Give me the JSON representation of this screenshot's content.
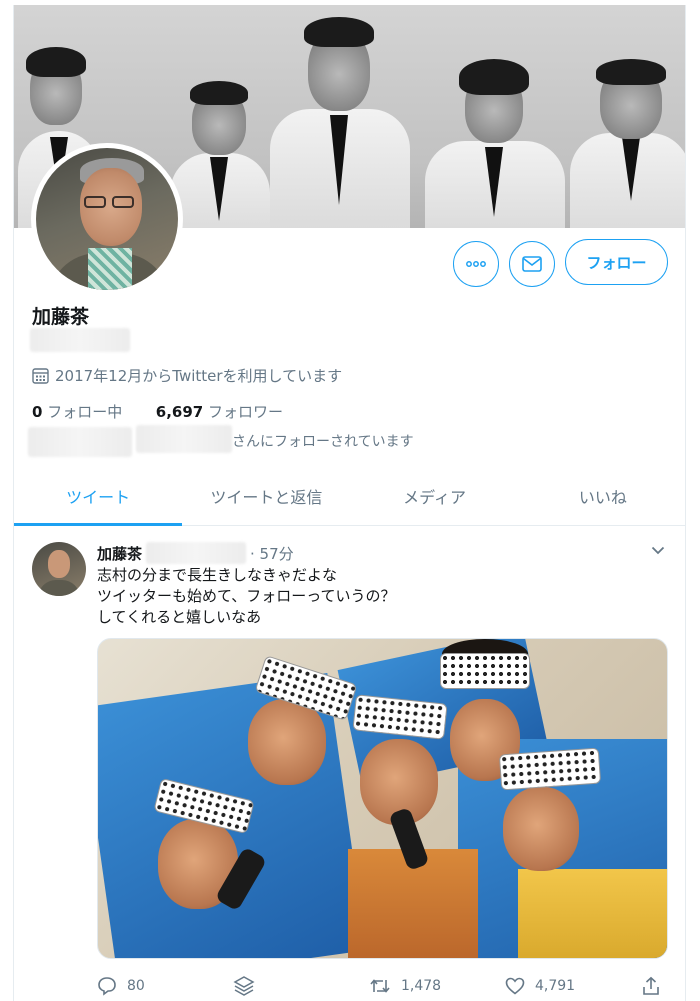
{
  "profile": {
    "display_name": "加藤茶",
    "joined": "2017年12月からTwitterを利用しています",
    "following_count": "0",
    "following_label": "フォロー中",
    "followers_count": "6,697",
    "followers_label": "フォロワー",
    "followed_by_suffix": "さんにフォローされています"
  },
  "buttons": {
    "more_icon": "more-dots-icon",
    "message_icon": "envelope-icon",
    "follow_label": "フォロー"
  },
  "tabs": [
    {
      "label": "ツイート",
      "active": true
    },
    {
      "label": "ツイートと返信",
      "active": false
    },
    {
      "label": "メディア",
      "active": false
    },
    {
      "label": "いいね",
      "active": false
    }
  ],
  "tweet": {
    "author": "加藤茶",
    "time": "· 57分",
    "lines": [
      "志村の分まで長生きしなきゃだよな",
      "ツイッターも始めて、フォローっていうの？",
      "してくれると嬉しいなあ"
    ],
    "replies": "80",
    "retweets": "1,478",
    "likes": "4,791"
  },
  "colors": {
    "accent": "#1da1f2",
    "secondary_text": "#657786",
    "primary_text": "#14171a",
    "border": "#e6ecf0"
  }
}
